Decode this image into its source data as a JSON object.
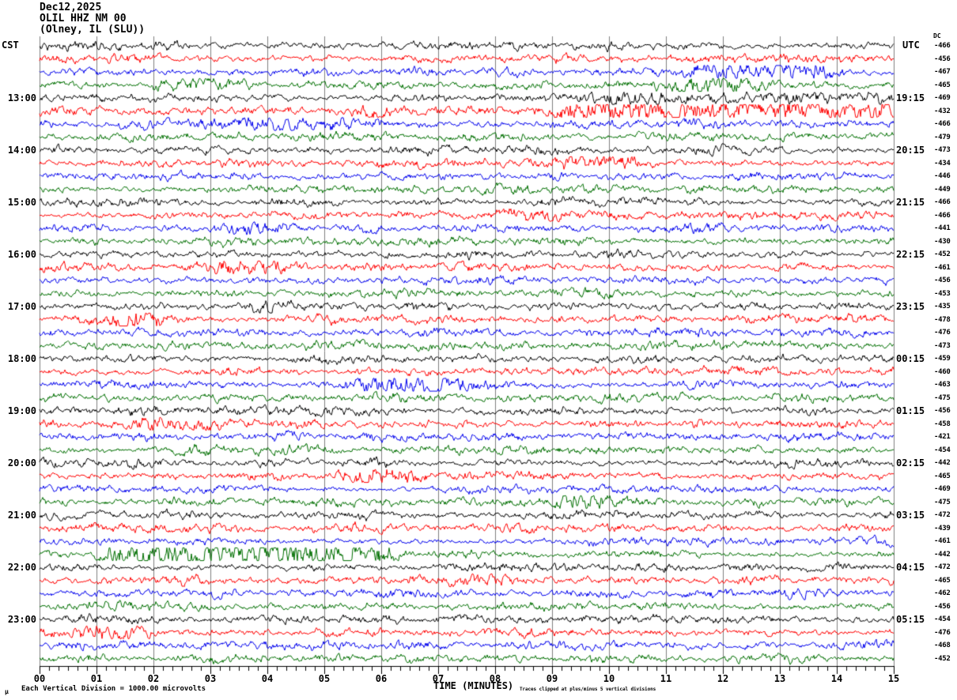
{
  "title": {
    "line1": "Dec12,2025",
    "line2": "OLIL HHZ NM 00",
    "line3": "(Olney, IL (SLU))"
  },
  "axes": {
    "left_header": "CST",
    "right_header": "UTC",
    "dc_header": "DC",
    "x_axis_label": "TIME (MINUTES)",
    "x_tick_labels": [
      "00",
      "01",
      "02",
      "03",
      "04",
      "05",
      "06",
      "07",
      "08",
      "09",
      "10",
      "11",
      "12",
      "13",
      "14",
      "15"
    ]
  },
  "footer": {
    "corner_glyph": "μ",
    "scale_note": "Each Vertical Division = 1000.00 microvolts",
    "clip_note": "Traces clipped at plus/minus 5 vertical divisions"
  },
  "colors": {
    "black": "#000000",
    "red": "#ff0000",
    "blue": "#0000ee",
    "green": "#006f00",
    "grid": "#808080",
    "background": "#ffffff"
  },
  "chart_data": {
    "type": "line",
    "subtype": "seismogram_helicorder",
    "station": "OLIL HHZ NM 00",
    "date": "Dec12,2025",
    "row_duration_minutes": 15,
    "x_range_minutes": [
      0,
      15
    ],
    "x_minor_ticks_per_minute": 5,
    "trace_color_cycle": [
      "black",
      "red",
      "blue",
      "green"
    ],
    "clip_divisions": 5,
    "microvolts_per_division": 1000.0,
    "rows": [
      {
        "cst": "",
        "utc": "",
        "dc": "-466"
      },
      {
        "cst": "",
        "utc": "",
        "dc": "-456"
      },
      {
        "cst": "",
        "utc": "",
        "dc": "-467"
      },
      {
        "cst": "",
        "utc": "",
        "dc": "-465"
      },
      {
        "cst": "13:00",
        "utc": "19:15",
        "dc": "-469"
      },
      {
        "cst": "",
        "utc": "",
        "dc": "-432"
      },
      {
        "cst": "",
        "utc": "",
        "dc": "-466"
      },
      {
        "cst": "",
        "utc": "",
        "dc": "-479"
      },
      {
        "cst": "14:00",
        "utc": "20:15",
        "dc": "-473"
      },
      {
        "cst": "",
        "utc": "",
        "dc": "-434"
      },
      {
        "cst": "",
        "utc": "",
        "dc": "-446"
      },
      {
        "cst": "",
        "utc": "",
        "dc": "-449"
      },
      {
        "cst": "15:00",
        "utc": "21:15",
        "dc": "-466"
      },
      {
        "cst": "",
        "utc": "",
        "dc": "-466"
      },
      {
        "cst": "",
        "utc": "",
        "dc": "-441"
      },
      {
        "cst": "",
        "utc": "",
        "dc": "-430"
      },
      {
        "cst": "16:00",
        "utc": "22:15",
        "dc": "-452"
      },
      {
        "cst": "",
        "utc": "",
        "dc": "-461"
      },
      {
        "cst": "",
        "utc": "",
        "dc": "-456"
      },
      {
        "cst": "",
        "utc": "",
        "dc": "-453"
      },
      {
        "cst": "17:00",
        "utc": "23:15",
        "dc": "-435"
      },
      {
        "cst": "",
        "utc": "",
        "dc": "-478"
      },
      {
        "cst": "",
        "utc": "",
        "dc": "-476"
      },
      {
        "cst": "",
        "utc": "",
        "dc": "-473"
      },
      {
        "cst": "18:00",
        "utc": "00:15",
        "dc": "-459"
      },
      {
        "cst": "",
        "utc": "",
        "dc": "-460"
      },
      {
        "cst": "",
        "utc": "",
        "dc": "-463"
      },
      {
        "cst": "",
        "utc": "",
        "dc": "-475"
      },
      {
        "cst": "19:00",
        "utc": "01:15",
        "dc": "-456"
      },
      {
        "cst": "",
        "utc": "",
        "dc": "-458"
      },
      {
        "cst": "",
        "utc": "",
        "dc": "-421"
      },
      {
        "cst": "",
        "utc": "",
        "dc": "-454"
      },
      {
        "cst": "20:00",
        "utc": "02:15",
        "dc": "-442"
      },
      {
        "cst": "",
        "utc": "",
        "dc": "-465"
      },
      {
        "cst": "",
        "utc": "",
        "dc": "-469"
      },
      {
        "cst": "",
        "utc": "",
        "dc": "-475"
      },
      {
        "cst": "21:00",
        "utc": "03:15",
        "dc": "-472"
      },
      {
        "cst": "",
        "utc": "",
        "dc": "-439"
      },
      {
        "cst": "",
        "utc": "",
        "dc": "-461"
      },
      {
        "cst": "",
        "utc": "",
        "dc": "-442"
      },
      {
        "cst": "22:00",
        "utc": "04:15",
        "dc": "-472"
      },
      {
        "cst": "",
        "utc": "",
        "dc": "-465"
      },
      {
        "cst": "",
        "utc": "",
        "dc": "-462"
      },
      {
        "cst": "",
        "utc": "",
        "dc": "-456"
      },
      {
        "cst": "23:00",
        "utc": "05:15",
        "dc": "-454"
      },
      {
        "cst": "",
        "utc": "",
        "dc": "-476"
      },
      {
        "cst": "",
        "utc": "",
        "dc": "-468"
      },
      {
        "cst": "",
        "utc": "",
        "dc": "-452"
      }
    ]
  }
}
